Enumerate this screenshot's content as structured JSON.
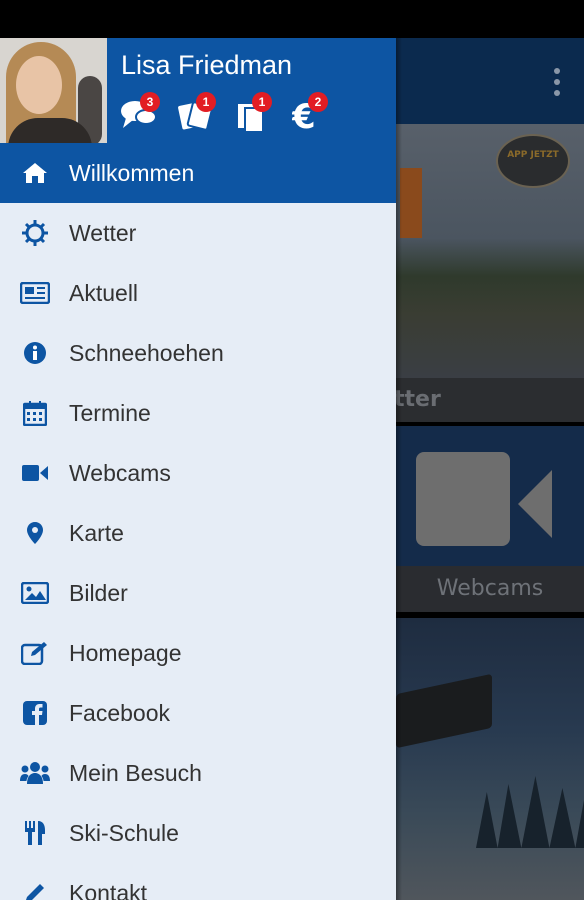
{
  "user": {
    "name": "Lisa Friedman"
  },
  "header_icons": [
    {
      "icon": "chat-icon",
      "badge": "3"
    },
    {
      "icon": "tickets-icon",
      "badge": "1"
    },
    {
      "icon": "copy-icon",
      "badge": "1"
    },
    {
      "icon": "euro-icon",
      "badge": "2"
    }
  ],
  "menu": [
    {
      "label": "Willkommen",
      "icon": "home-icon",
      "active": true
    },
    {
      "label": "Wetter",
      "icon": "sun-icon"
    },
    {
      "label": "Aktuell",
      "icon": "newspaper-icon"
    },
    {
      "label": "Schneehoehen",
      "icon": "info-icon"
    },
    {
      "label": "Termine",
      "icon": "calendar-icon"
    },
    {
      "label": "Webcams",
      "icon": "video-camera-icon"
    },
    {
      "label": "Karte",
      "icon": "map-marker-icon"
    },
    {
      "label": "Bilder",
      "icon": "picture-icon"
    },
    {
      "label": "Homepage",
      "icon": "edit-icon"
    },
    {
      "label": "Facebook",
      "icon": "facebook-icon"
    },
    {
      "label": "Mein Besuch",
      "icon": "group-icon"
    },
    {
      "label": "Ski-Schule",
      "icon": "cutlery-icon"
    },
    {
      "label": "Kontakt",
      "icon": "pencil-icon"
    }
  ],
  "background": {
    "caption_partial": "tter",
    "tile_label": "Webcams",
    "logo_text": "APP JETZT"
  },
  "colors": {
    "primary": "#0d55a3",
    "drawer_bg": "#e6edf6",
    "badge": "#e21d24"
  }
}
